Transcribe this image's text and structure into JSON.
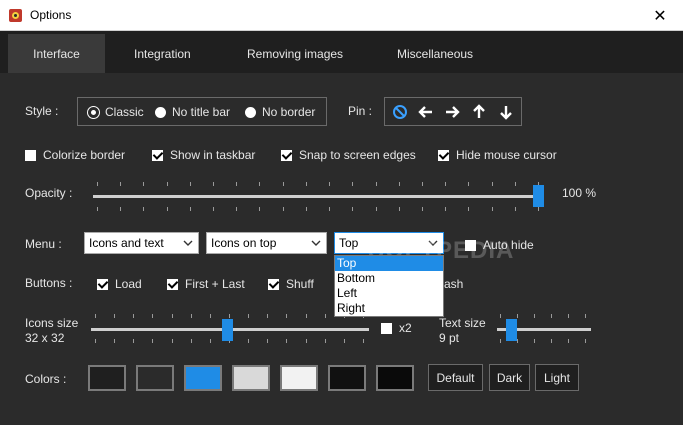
{
  "window": {
    "title": "Options"
  },
  "tabs": [
    {
      "label": "Interface"
    },
    {
      "label": "Integration"
    },
    {
      "label": "Removing images"
    },
    {
      "label": "Miscellaneous"
    }
  ],
  "style": {
    "label": "Style :",
    "options": [
      {
        "label": "Classic",
        "selected": true
      },
      {
        "label": "No title bar",
        "selected": false
      },
      {
        "label": "No border",
        "selected": false
      }
    ]
  },
  "pin": {
    "label": "Pin :",
    "icons": [
      "no-pin-icon",
      "arrow-left-icon",
      "arrow-right-icon",
      "arrow-up-icon",
      "arrow-down-icon"
    ]
  },
  "checkboxes": [
    {
      "label": "Colorize border",
      "checked": false
    },
    {
      "label": "Show in taskbar",
      "checked": true
    },
    {
      "label": "Snap to screen edges",
      "checked": true
    },
    {
      "label": "Hide mouse cursor",
      "checked": true
    }
  ],
  "opacity": {
    "label": "Opacity :",
    "value_text": "100 %",
    "value": 100
  },
  "menu": {
    "label": "Menu :",
    "select1": "Icons and text",
    "select2": "Icons on top",
    "select3": "Top",
    "options": [
      "Top",
      "Bottom",
      "Left",
      "Right"
    ],
    "auto_hide": {
      "label": "Auto hide",
      "checked": false
    }
  },
  "buttons": {
    "label": "Buttons :",
    "items": [
      {
        "label": "Load",
        "checked": true
      },
      {
        "label": "First + Last",
        "checked": true
      },
      {
        "label": "Shuff",
        "checked": true
      },
      {
        "label": "ash",
        "checked": false
      }
    ]
  },
  "icons_size": {
    "label": "Icons size",
    "value_text": "32 x 32",
    "x2_label": "x2",
    "x2_checked": false
  },
  "text_size": {
    "label": "Text size",
    "value_text": "9 pt"
  },
  "colors": {
    "label": "Colors :",
    "swatches": [
      "#1f1f1f",
      "#2b2b2b",
      "#1f8ce6",
      "#d9d9d9",
      "#f2f2f2",
      "#111111",
      "#0a0a0a"
    ],
    "default_label": "Default",
    "dark_label": "Dark",
    "light_label": "Light"
  },
  "watermark": "SOFTPEDIA"
}
